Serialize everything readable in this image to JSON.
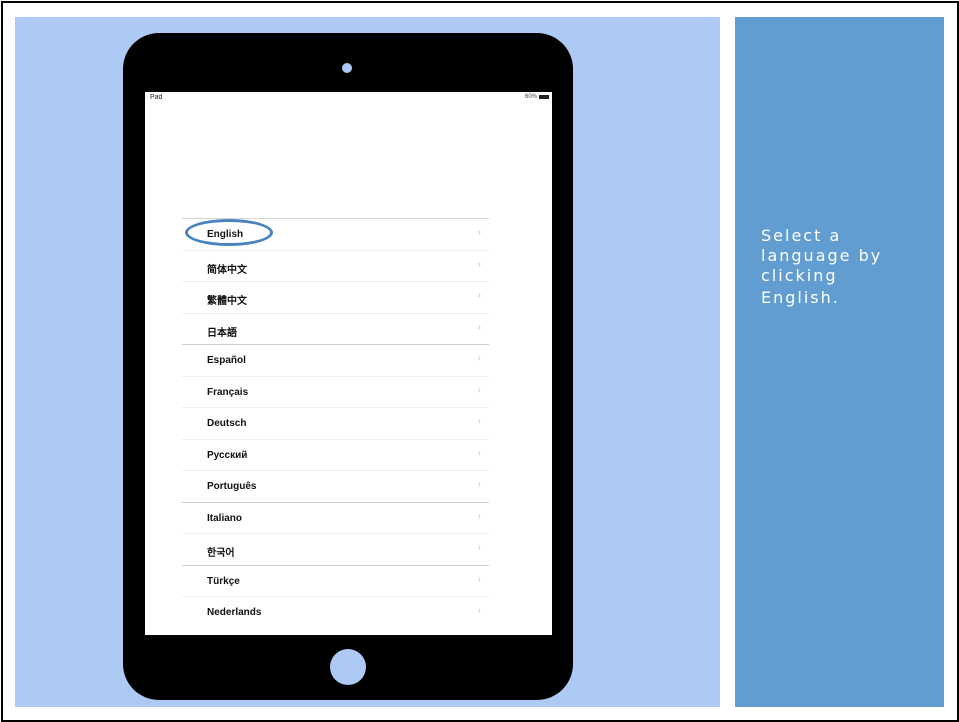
{
  "caption": {
    "line1": "Select a",
    "line2": "language by",
    "line3": "clicking",
    "line4": "English."
  },
  "status_bar": {
    "left": "Pad",
    "right": "60%"
  },
  "languages": [
    "English",
    "简体中文",
    "繁體中文",
    "日本語",
    "Español",
    "Français",
    "Deutsch",
    "Русский",
    "Português",
    "Italiano",
    "한국어",
    "Türkçe",
    "Nederlands"
  ],
  "chevron": "›",
  "colors": {
    "left_panel": "#adcaf4",
    "right_panel": "#629dd1",
    "highlight": "#4a82c0"
  },
  "icons": [
    "camera-icon",
    "home-button-icon",
    "battery-icon",
    "chevron-right-icon"
  ]
}
